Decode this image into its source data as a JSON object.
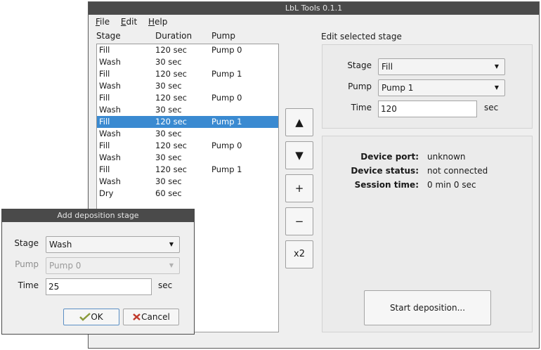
{
  "main_window": {
    "title": "LbL Tools 0.1.1",
    "menu": [
      {
        "mnemonic": "F",
        "rest": "ile"
      },
      {
        "mnemonic": "E",
        "rest": "dit"
      },
      {
        "mnemonic": "H",
        "rest": "elp"
      }
    ],
    "columns": {
      "stage": "Stage",
      "duration": "Duration",
      "pump": "Pump"
    },
    "stages": [
      {
        "stage": "Fill",
        "duration": "120 sec",
        "pump": "Pump 0"
      },
      {
        "stage": "Wash",
        "duration": "30 sec",
        "pump": ""
      },
      {
        "stage": "Fill",
        "duration": "120 sec",
        "pump": "Pump 1"
      },
      {
        "stage": "Wash",
        "duration": "30 sec",
        "pump": ""
      },
      {
        "stage": "Fill",
        "duration": "120 sec",
        "pump": "Pump 0"
      },
      {
        "stage": "Wash",
        "duration": "30 sec",
        "pump": ""
      },
      {
        "stage": "Fill",
        "duration": "120 sec",
        "pump": "Pump 1"
      },
      {
        "stage": "Wash",
        "duration": "30 sec",
        "pump": ""
      },
      {
        "stage": "Fill",
        "duration": "120 sec",
        "pump": "Pump 0"
      },
      {
        "stage": "Wash",
        "duration": "30 sec",
        "pump": ""
      },
      {
        "stage": "Fill",
        "duration": "120 sec",
        "pump": "Pump 1"
      },
      {
        "stage": "Wash",
        "duration": "30 sec",
        "pump": ""
      },
      {
        "stage": "Dry",
        "duration": "60 sec",
        "pump": ""
      }
    ],
    "selected_row": 6,
    "side_buttons": {
      "up": "▲",
      "down": "▼",
      "add": "+",
      "remove": "−",
      "duplicate": "x2"
    },
    "edit": {
      "heading": "Edit selected stage",
      "stage_label": "Stage",
      "stage_value": "Fill",
      "pump_label": "Pump",
      "pump_value": "Pump 1",
      "time_label": "Time",
      "time_value": "120",
      "time_unit": "sec"
    },
    "device": {
      "port_label": "Device port:",
      "port_value": "unknown",
      "status_label": "Device status:",
      "status_value": "not connected",
      "session_label": "Session time:",
      "session_value": "0 min 0 sec"
    },
    "start_button": "Start deposition..."
  },
  "dialog": {
    "title": "Add deposition stage",
    "stage_label": "Stage",
    "stage_value": "Wash",
    "pump_label": "Pump",
    "pump_value": "Pump 0",
    "time_label": "Time",
    "time_value": "25",
    "time_unit": "sec",
    "ok_label": "OK",
    "cancel_label": "Cancel"
  },
  "colors": {
    "selection": "#3a8ad1",
    "titlebar": "#4a4a4a",
    "ok_icon": "#8a9a3a",
    "cancel_icon": "#c0392b"
  }
}
